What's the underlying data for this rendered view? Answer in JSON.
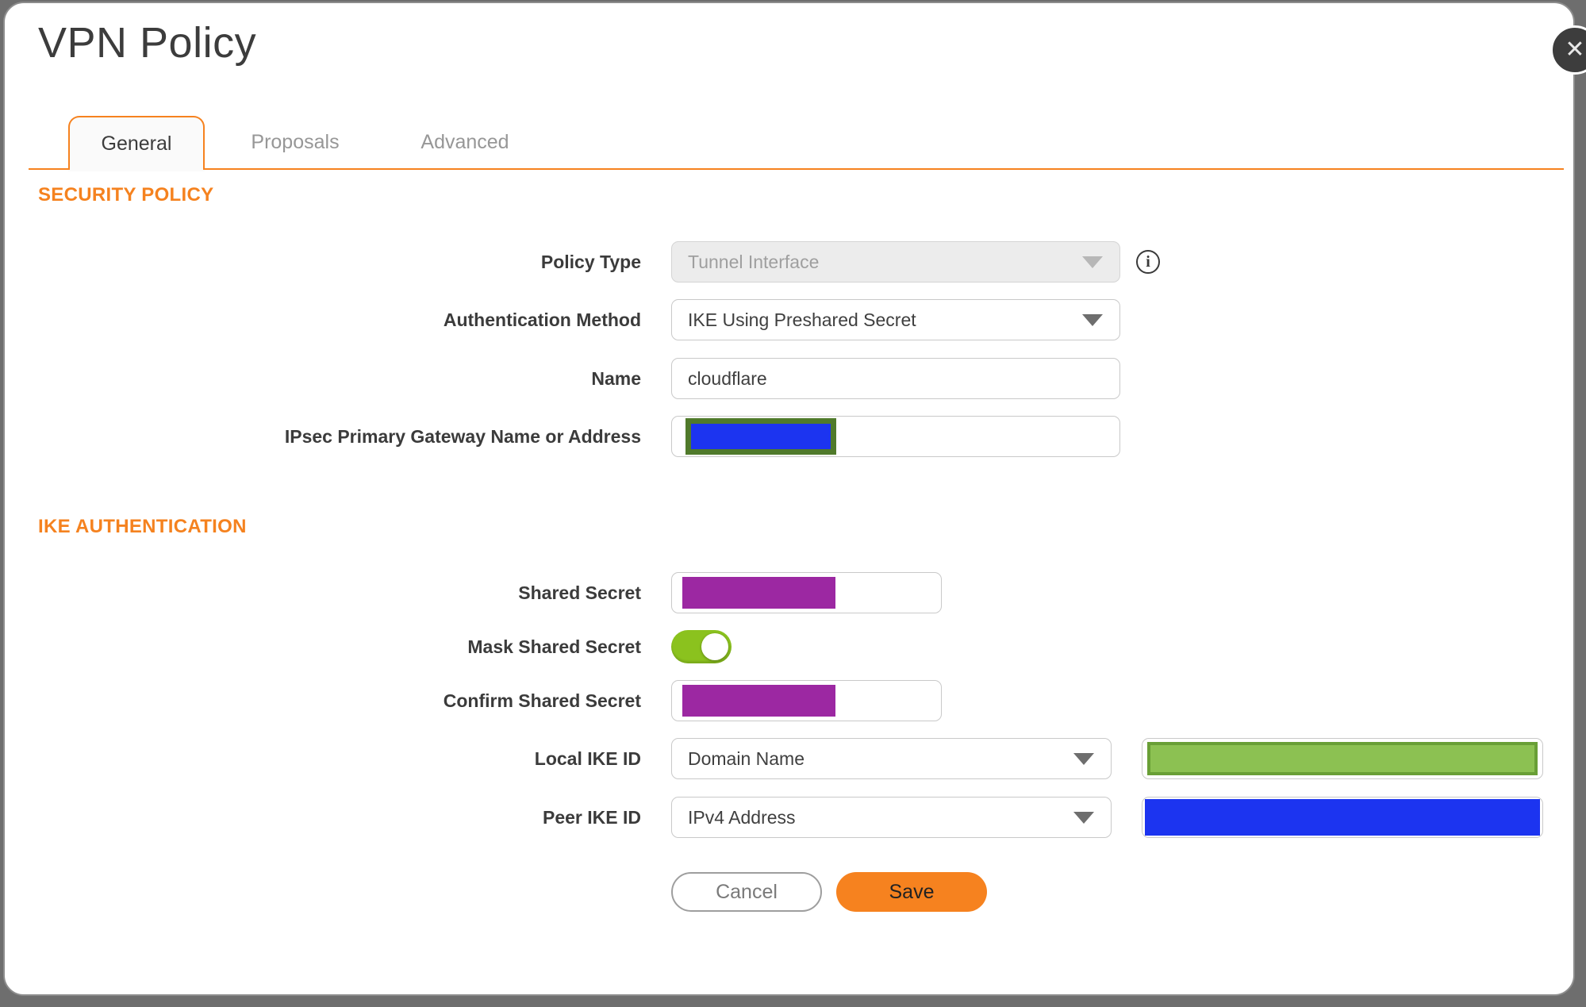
{
  "window": {
    "title": "VPN Policy"
  },
  "icons": {
    "close": "✕",
    "info": "i"
  },
  "tabs": {
    "general": "General",
    "proposals": "Proposals",
    "advanced": "Advanced",
    "active_tab": "General"
  },
  "security_policy": {
    "heading": "SECURITY POLICY",
    "policy_type": {
      "label": "Policy Type",
      "value": "Tunnel Interface",
      "disabled": true
    },
    "authentication_method": {
      "label": "Authentication Method",
      "value": "IKE Using Preshared Secret"
    },
    "name": {
      "label": "Name",
      "value": "cloudflare"
    },
    "gateway": {
      "label": "IPsec Primary Gateway Name or Address",
      "value_redacted": true
    }
  },
  "ike_authentication": {
    "heading": "IKE AUTHENTICATION",
    "shared_secret": {
      "label": "Shared Secret",
      "value_redacted": true
    },
    "mask_shared_secret": {
      "label": "Mask Shared Secret",
      "enabled": true
    },
    "confirm_shared_secret": {
      "label": "Confirm Shared Secret",
      "value_redacted": true
    },
    "local_ike_id": {
      "label": "Local IKE ID",
      "type": "Domain Name",
      "value_redacted": true
    },
    "peer_ike_id": {
      "label": "Peer IKE ID",
      "type": "IPv4 Address",
      "value_redacted": true
    }
  },
  "actions": {
    "cancel": "Cancel",
    "save": "Save"
  },
  "colors": {
    "accent_orange": "#F6821F",
    "toggle_green_on": "#8BC21E",
    "redaction_purple": "#9C28A2",
    "redaction_blue": "#1C34F0",
    "redaction_green": "#8CC152",
    "redaction_olive_border": "#507A2B"
  }
}
